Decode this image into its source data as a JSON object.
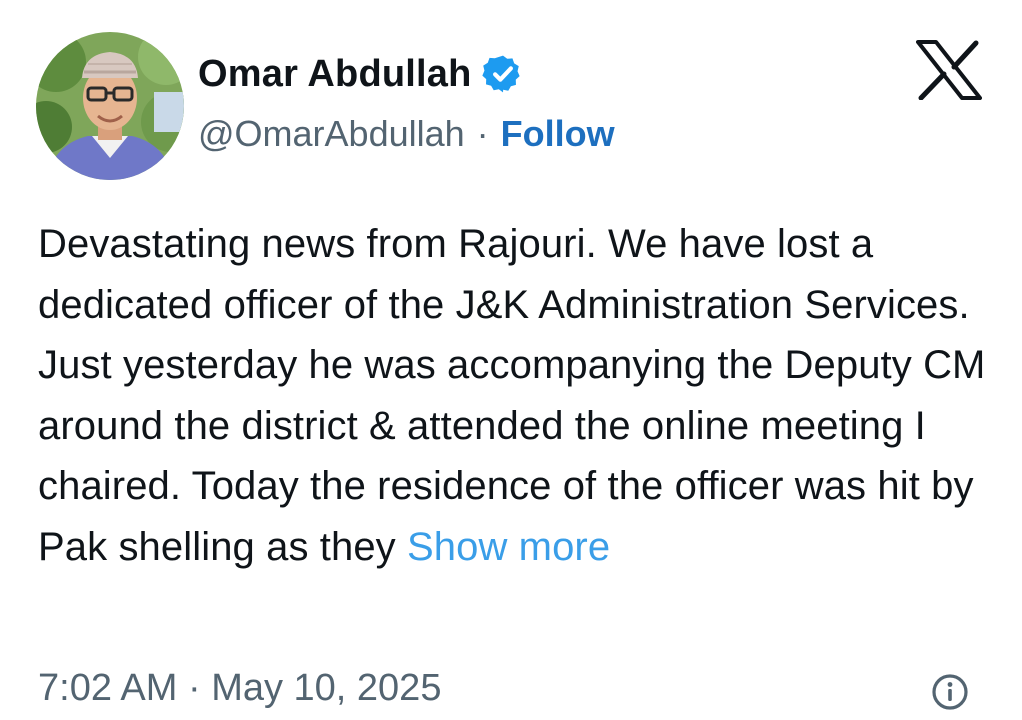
{
  "author": {
    "name": "Omar Abdullah",
    "handle": "@OmarAbdullah",
    "separator": "·",
    "follow_label": "Follow",
    "verified_icon": "verified-badge-icon",
    "avatar_icon": "profile-photo"
  },
  "platform": {
    "logo_icon": "x-logo-icon"
  },
  "tweet": {
    "text": "Devastating news from Rajouri. We have lost a dedicated officer of the J&K Administration Services. Just yesterday he was accompanying the Deputy CM around the district & attended the online meeting I chaired. Today the residence of the officer was hit by Pak shelling as they",
    "show_more_label": "Show more",
    "timestamp": "7:02 AM · May 10, 2025",
    "info_icon": "info-icon"
  },
  "colors": {
    "follow": "#1d6fbf",
    "show_more": "#3a9ee8",
    "verified": "#1d9bf0",
    "muted": "#536471",
    "text": "#0f1419"
  }
}
